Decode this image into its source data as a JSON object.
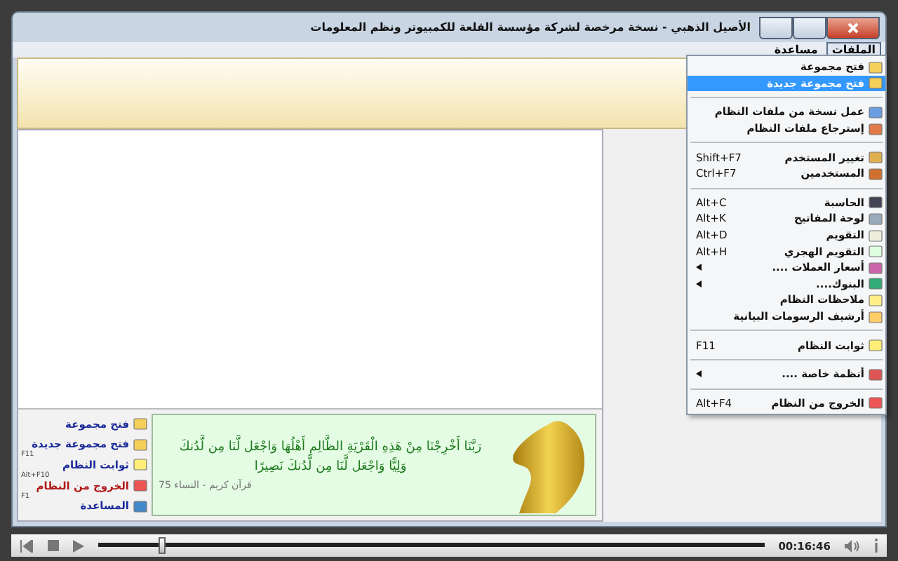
{
  "window": {
    "title": "الأصيل الذهبي - نسخة مرخصة لشركة مؤسسة القلعة للكمبيوتر ونظم المعلومات"
  },
  "menu_bar": [
    {
      "label": "الملفات",
      "selected": true
    },
    {
      "label": "مساعدة",
      "selected": false
    }
  ],
  "menu": [
    {
      "kind": "item",
      "label": "فتح مجموعة",
      "submenu": false,
      "selected": false
    },
    {
      "kind": "item",
      "label": "فتح مجموعة جديدة",
      "submenu": false,
      "selected": true
    },
    {
      "kind": "separator"
    },
    {
      "kind": "item",
      "label": "عمل نسخة من ملفات النظام",
      "submenu": false,
      "selected": false
    },
    {
      "kind": "item",
      "label": "إسترجاع ملفات النظام",
      "submenu": false,
      "selected": false
    },
    {
      "kind": "separator"
    },
    {
      "kind": "item",
      "label": "تغيير المستخدم",
      "shortcut": "Shift+F7",
      "submenu": false,
      "selected": false
    },
    {
      "kind": "item",
      "label": "المستخدمين",
      "shortcut": "Ctrl+F7",
      "submenu": false,
      "selected": false
    },
    {
      "kind": "separator"
    },
    {
      "kind": "item",
      "label": "الحاسبة",
      "shortcut": "Alt+C",
      "submenu": false,
      "selected": false
    },
    {
      "kind": "item",
      "label": "لوحة المفاتيح",
      "shortcut": "Alt+K",
      "submenu": false,
      "selected": false
    },
    {
      "kind": "item",
      "label": "التقويم",
      "shortcut": "Alt+D",
      "submenu": false,
      "selected": false
    },
    {
      "kind": "item",
      "label": "التقويم الهجري",
      "shortcut": "Alt+H",
      "submenu": false,
      "selected": false
    },
    {
      "kind": "item",
      "label": "أسعار العملات ....",
      "submenu": true,
      "selected": false
    },
    {
      "kind": "item",
      "label": "البنوك....",
      "submenu": true,
      "selected": false
    },
    {
      "kind": "item",
      "label": "ملاحظات النظام",
      "submenu": false,
      "selected": false
    },
    {
      "kind": "item",
      "label": "أرشيف الرسومات البيانية",
      "submenu": false,
      "selected": false
    },
    {
      "kind": "separator"
    },
    {
      "kind": "item",
      "label": "ثوابت النظام",
      "shortcut": "F11",
      "submenu": false,
      "selected": false
    },
    {
      "kind": "separator"
    },
    {
      "kind": "item",
      "label": "أنظمة خاصة ....",
      "submenu": true,
      "selected": false
    },
    {
      "kind": "separator"
    },
    {
      "kind": "item",
      "label": "الخروج من النظام",
      "shortcut": "Alt+F4",
      "submenu": false,
      "selected": false
    }
  ],
  "quick_links": [
    {
      "label": "فتح مجموعة",
      "color": "#1a2a9a"
    },
    {
      "label": "فتح مجموعة جديدة",
      "color": "#1a2a9a"
    },
    {
      "label": "ثوابت النظام",
      "shortcut": "F11",
      "color": "#1a2a9a"
    },
    {
      "label": "الخروج من النظام",
      "shortcut": "Alt+F10",
      "color": "#b01818"
    },
    {
      "label": "المساعدة",
      "shortcut": "F1",
      "color": "#1a2a9a"
    }
  ],
  "verse": {
    "lines": [
      "رَبَّنَا أَخْرِجْنَا مِنْ هَذِهِ الْقَرْيَةِ الظَّالِمِ أَهْلُهَا وَاجْعَل لَّنَا مِن لَّدُنكَ",
      "وَلِيًّا وَاجْعَل لَّنَا مِن لَّدُنكَ نَصِيرًا"
    ],
    "source": "قرآن كريم - النساء 75"
  },
  "player": {
    "level": 0.095,
    "time": "00:16:46"
  }
}
